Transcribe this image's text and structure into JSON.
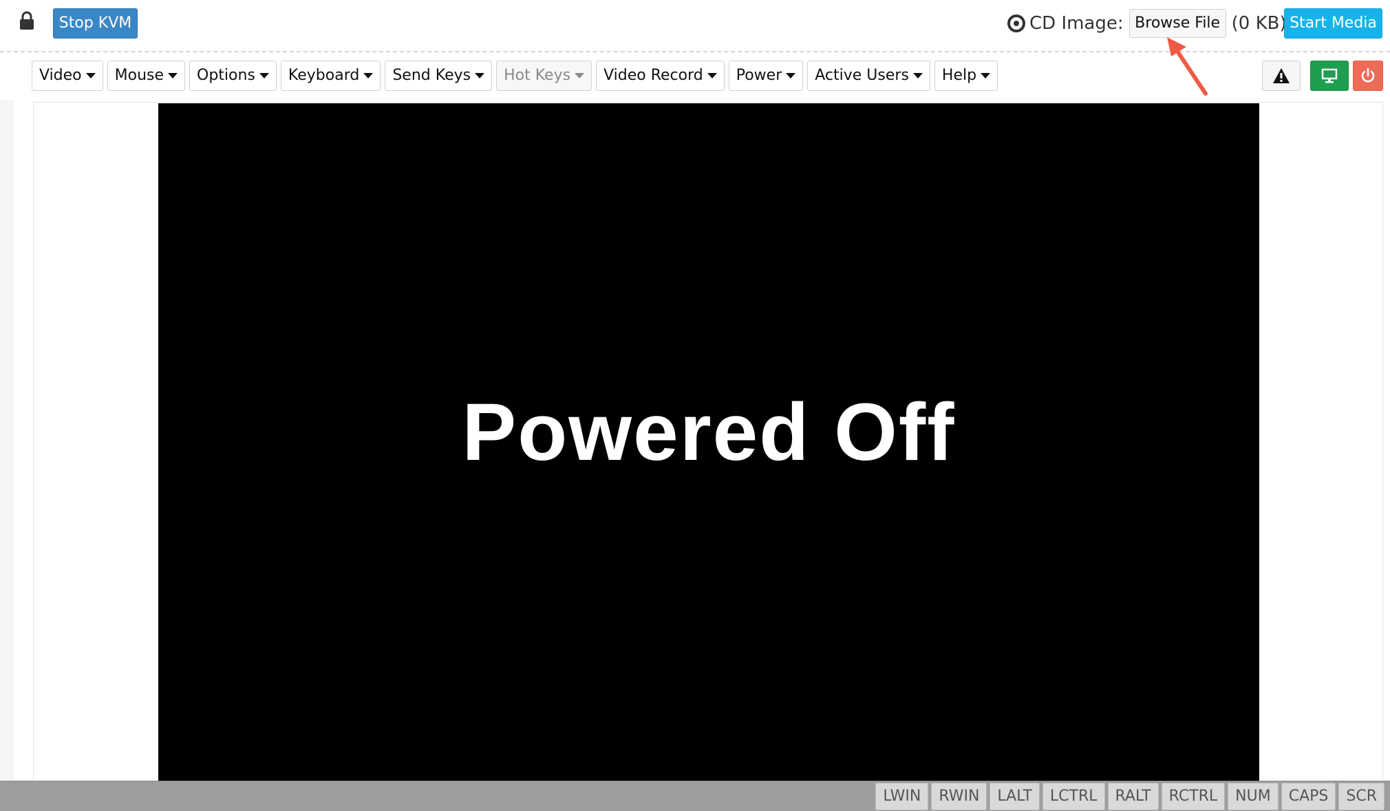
{
  "topbar": {
    "stop_kvm_label": "Stop KVM",
    "cd_image_label": "CD Image:",
    "browse_file_label": "Browse File",
    "file_size": "(0 KB)",
    "start_media_label": "Start Media"
  },
  "menu": {
    "items": [
      {
        "label": "Video",
        "enabled": true
      },
      {
        "label": "Mouse",
        "enabled": true
      },
      {
        "label": "Options",
        "enabled": true
      },
      {
        "label": "Keyboard",
        "enabled": true
      },
      {
        "label": "Send Keys",
        "enabled": true
      },
      {
        "label": "Hot Keys",
        "enabled": false
      },
      {
        "label": "Video Record",
        "enabled": true
      },
      {
        "label": "Power",
        "enabled": true
      },
      {
        "label": "Active Users",
        "enabled": true
      },
      {
        "label": "Help",
        "enabled": true
      }
    ]
  },
  "toolbar_icons": {
    "warning": "warning-icon",
    "monitor": "monitor-icon",
    "power": "power-icon"
  },
  "screen": {
    "message": "Powered Off"
  },
  "statusbar": {
    "keys": [
      "LWIN",
      "RWIN",
      "LALT",
      "LCTRL",
      "RALT",
      "RCTRL",
      "NUM",
      "CAPS",
      "SCR"
    ]
  },
  "colors": {
    "stop_kvm": "#3a87c8",
    "start_media": "#17b2ea",
    "monitor_button": "#1e9e4f",
    "power_button": "#ee6b57",
    "annotation_arrow": "#ef5a47"
  }
}
